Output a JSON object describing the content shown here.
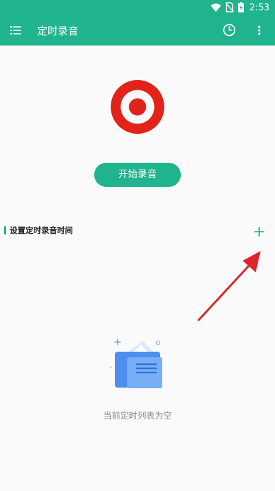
{
  "status_bar": {
    "time": "2:53",
    "icons": [
      "wifi-icon",
      "no-sim-icon",
      "battery-charging-icon"
    ]
  },
  "app_bar": {
    "title": "定时录音",
    "menu_icon": "list-icon",
    "history_icon": "clock-icon",
    "more_icon": "more-vertical-icon"
  },
  "record": {
    "icon": "record-target-icon",
    "start_label": "开始录音"
  },
  "schedule": {
    "section_title": "设置定时录音时间",
    "add_icon": "plus-icon",
    "empty_text": "当前定时列表为空"
  },
  "colors": {
    "accent": "#1fb48e",
    "record_red": "#e2231a",
    "annotation_red": "#d9262b",
    "background": "#fafafa"
  }
}
